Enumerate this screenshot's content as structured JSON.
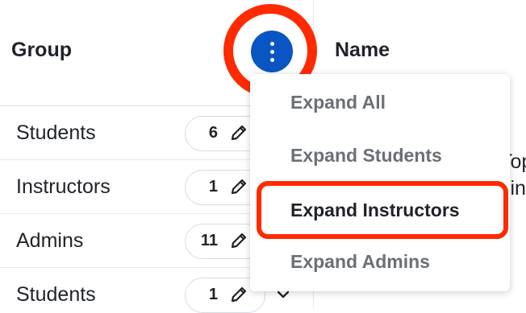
{
  "table": {
    "headers": {
      "group": "Group",
      "name": "Name"
    },
    "rows": [
      {
        "group": "Students",
        "count": "6"
      },
      {
        "group": "Instructors",
        "count": "1"
      },
      {
        "group": "Admins",
        "count": "11"
      },
      {
        "group": "Students",
        "count": "1"
      }
    ],
    "name_peek": [
      "Top",
      "sin"
    ]
  },
  "column_menu": {
    "button_icon": "kebab-menu-icon",
    "items": [
      {
        "label": "Expand All"
      },
      {
        "label": "Expand Students"
      },
      {
        "label": "Expand Instructors",
        "highlighted": true
      },
      {
        "label": "Expand Admins"
      }
    ]
  },
  "icons": {
    "edit": "pencil-icon",
    "expand": "chevron-down-icon"
  },
  "colors": {
    "accent": "#0a55c4",
    "annotation": "#ff2a00"
  }
}
